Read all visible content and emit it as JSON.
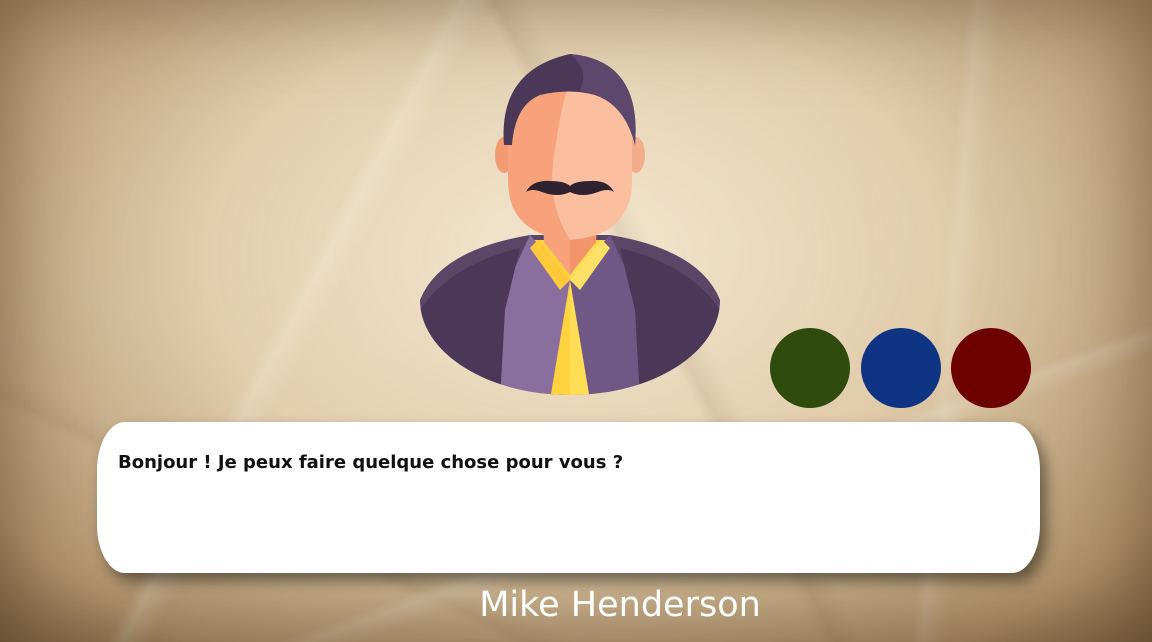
{
  "speaker": {
    "name": "Mike Henderson",
    "portrait_icon": "man-with-mustache-avatar-icon"
  },
  "dialog": {
    "text": "Bonjour ! Je peux faire quelque chose pour vous ?"
  },
  "choices": [
    {
      "name": "green-choice-button",
      "color": "#2e4a0c"
    },
    {
      "name": "blue-choice-button",
      "color": "#0f3483"
    },
    {
      "name": "red-choice-button",
      "color": "#6d0000"
    }
  ],
  "colors": {
    "background": "#e3d1b3",
    "dialog_box": "#ffffff",
    "dialog_text": "#111111",
    "name_text": "#ffffff"
  }
}
